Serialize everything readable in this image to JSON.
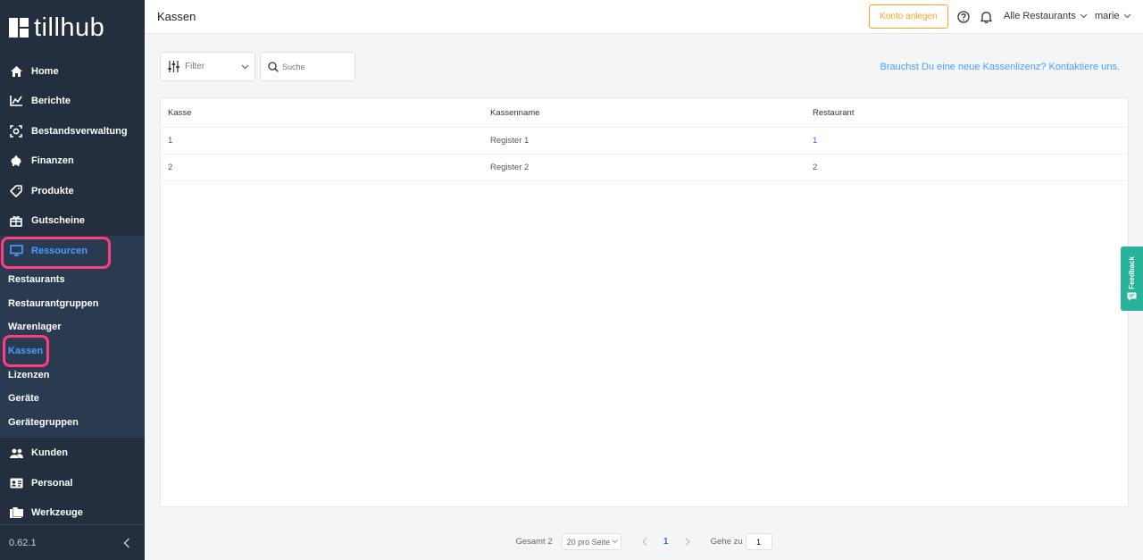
{
  "brand": {
    "name": "tillhub"
  },
  "sidebar": {
    "items": [
      {
        "label": "Home",
        "icon": "home-icon"
      },
      {
        "label": "Berichte",
        "icon": "chart-icon"
      },
      {
        "label": "Bestandsverwaltung",
        "icon": "inventory-icon"
      },
      {
        "label": "Finanzen",
        "icon": "piggy-bank-icon"
      },
      {
        "label": "Produkte",
        "icon": "tag-icon"
      },
      {
        "label": "Gutscheine",
        "icon": "gift-icon"
      },
      {
        "label": "Ressourcen",
        "icon": "monitor-icon"
      }
    ],
    "sub_items": [
      "Restaurants",
      "Restaurantgruppen",
      "Warenlager",
      "Kassen",
      "Lizenzen",
      "Geräte",
      "Gerätegruppen"
    ],
    "bottom_items": [
      {
        "label": "Kunden",
        "icon": "users-icon"
      },
      {
        "label": "Personal",
        "icon": "id-card-icon"
      },
      {
        "label": "Werkzeuge",
        "icon": "folder-icon"
      }
    ],
    "version": "0.62.1"
  },
  "header": {
    "title": "Kassen",
    "konto_label": "Konto anlegen",
    "restaurant_select": "Alle Restaurants",
    "user": "marie"
  },
  "toolbar": {
    "filter_label": "Filter",
    "search_placeholder": "Suche",
    "lizenz_link": "Brauchst Du eine neue Kassenlizenz? Kontaktiere uns."
  },
  "table": {
    "columns": [
      "Kasse",
      "Kassenname",
      "Restaurant"
    ],
    "rows": [
      [
        "1",
        "Register 1",
        "1"
      ],
      [
        "2",
        "Register 2",
        "2"
      ]
    ]
  },
  "pagination": {
    "total": "Gesamt 2",
    "per_page": "20 pro Seite",
    "current_page": "1",
    "goto_label": "Gehe zu",
    "goto_value": "1"
  },
  "feedback": {
    "label": "Feedback"
  },
  "colors": {
    "sidebar_bg": "#232f3e",
    "accent": "#4a9eff",
    "highlight": "#ff3d7f",
    "konto": "#f5a623",
    "feedback": "#26b39a"
  }
}
